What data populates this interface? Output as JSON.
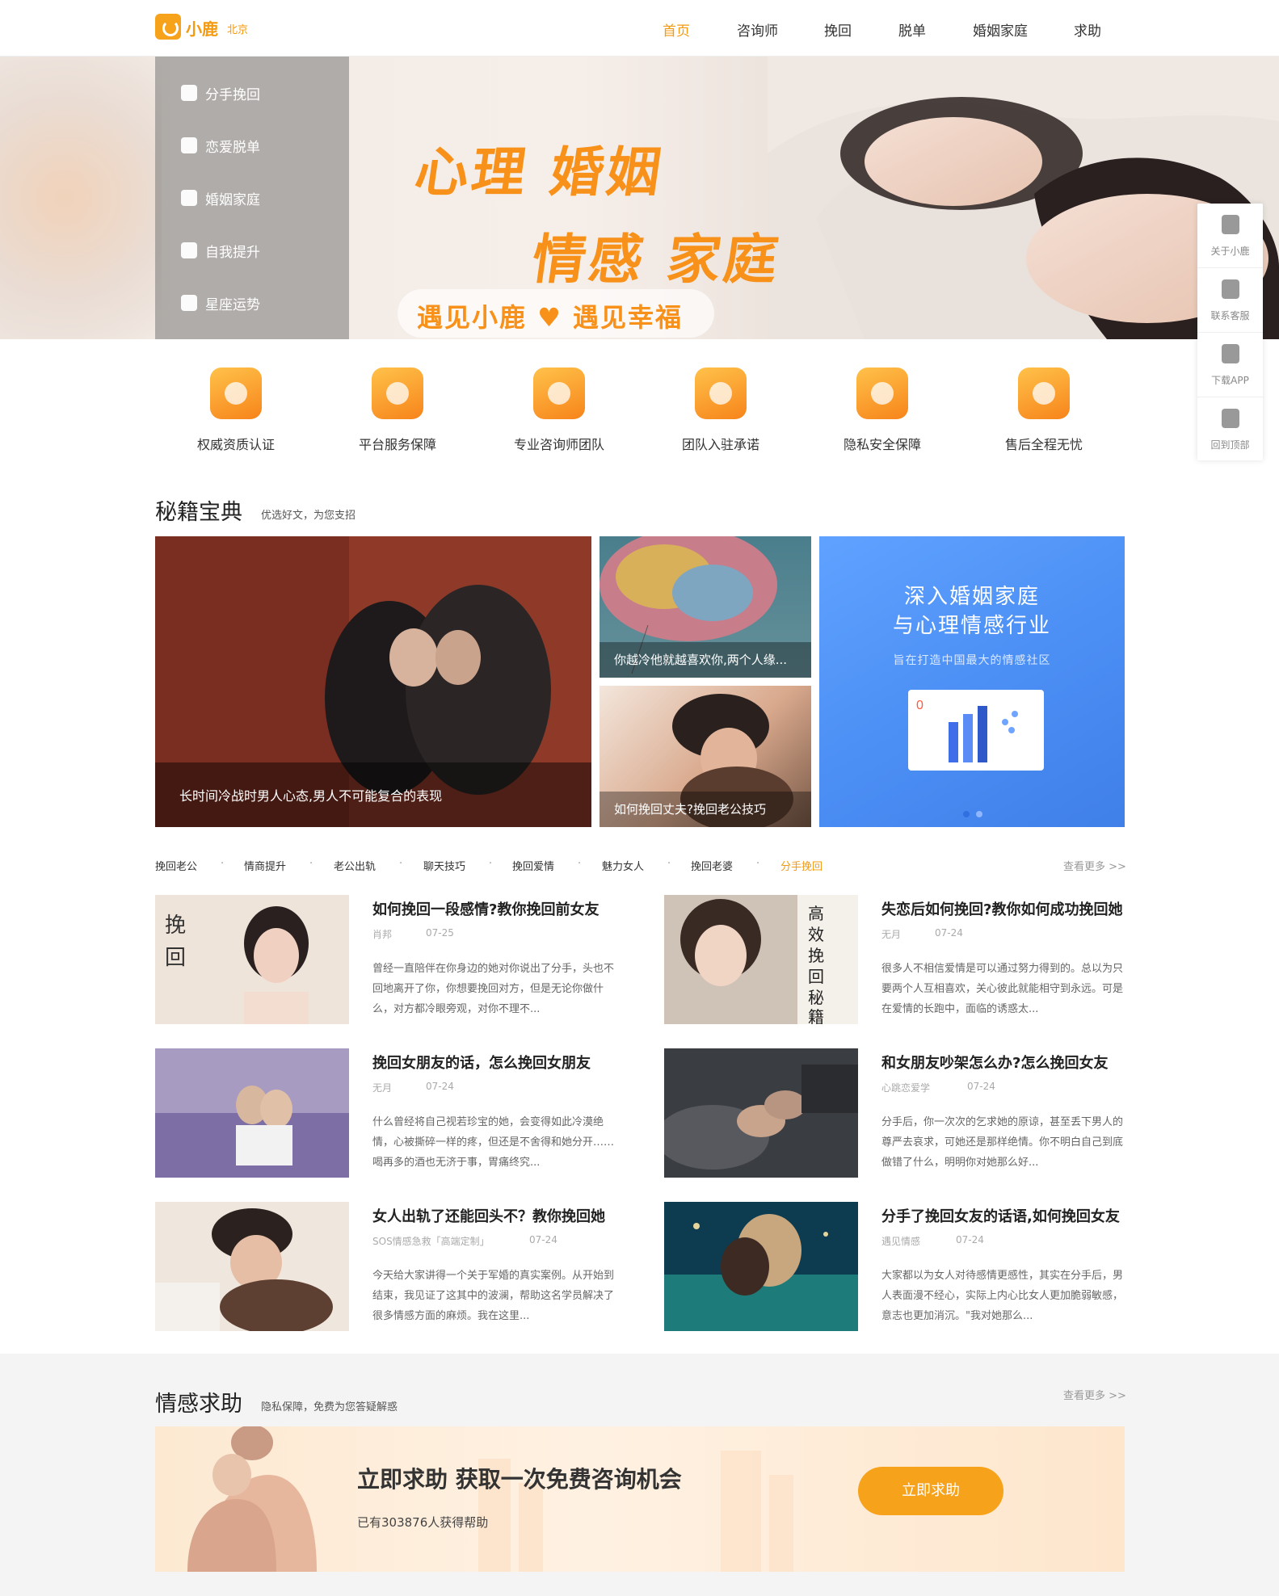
{
  "header": {
    "logo_text": "小鹿",
    "city": "北京",
    "nav": [
      "首页",
      "咨询师",
      "挽回",
      "脱单",
      "婚姻家庭",
      "求助"
    ]
  },
  "banner": {
    "side_menu": [
      "分手挽回",
      "恋爱脱单",
      "婚姻家庭",
      "自我提升",
      "星座运势"
    ],
    "headline_line1": "心理 婚姻",
    "headline_line2": "情感 家庭",
    "slogan": "遇见小鹿 ♥ 遇见幸福"
  },
  "float_bar": [
    "关于小鹿",
    "联系客服",
    "下载APP",
    "回到顶部"
  ],
  "features": [
    "权威资质认证",
    "平台服务保障",
    "专业咨询师团队",
    "团队入驻承诺",
    "隐私安全保障",
    "售后全程无忧"
  ],
  "secrets": {
    "title": "秘籍宝典",
    "subtitle": "优选好文，为您支招",
    "big_caption": "长时间冷战时男人心态,男人不可能复合的表现",
    "small1_caption": "你越冷他就越喜欢你,两个人缘...",
    "small2_caption": "如何挽回丈夫?挽回老公技巧",
    "blue_title1": "深入婚姻家庭",
    "blue_title2": "与心理情感行业",
    "blue_sub": "旨在打造中国最大的情感社区",
    "tags": [
      "挽回老公",
      "情商提升",
      "老公出轨",
      "聊天技巧",
      "挽回爱情",
      "魅力女人",
      "挽回老婆",
      "分手挽回"
    ],
    "more": "查看更多 >>"
  },
  "articles": [
    {
      "title": "如何挽回一段感情?教你挽回前女友",
      "author": "肖邦",
      "date": "07-25",
      "desc": "曾经一直陪伴在你身边的她对你说出了分手，头也不回地离开了你，你想要挽回对方，但是无论你做什么，对方都冷眼旁观，对你不理不..."
    },
    {
      "title": "失恋后如何挽回?教你如何成功挽回她",
      "author": "无月",
      "date": "07-24",
      "desc": "很多人不相信爱情是可以通过努力得到的。总以为只要两个人互相喜欢，关心彼此就能相守到永远。可是在爱情的长跑中，面临的诱惑太..."
    },
    {
      "title": "挽回女朋友的话，怎么挽回女朋友",
      "author": "无月",
      "date": "07-24",
      "desc": "什么曾经将自己视若珍宝的她，会变得如此冷漠绝情，心被撕碎一样的疼，但还是不舍得和她分开……喝再多的酒也无济于事，胃痛终究..."
    },
    {
      "title": "和女朋友吵架怎么办?怎么挽回女友",
      "author": "心跳恋爱学",
      "date": "07-24",
      "desc": "分手后，你一次次的乞求她的原谅，甚至丢下男人的尊严去哀求，可她还是那样绝情。你不明白自己到底做错了什么，明明你对她那么好..."
    },
    {
      "title": "女人出轨了还能回头不？教你挽回她",
      "author": "SOS情感急救「高端定制」",
      "date": "07-24",
      "desc": "今天给大家讲得一个关于军婚的真实案例。从开始到结束，我见证了这其中的波澜，帮助这名学员解决了很多情感方面的麻烦。我在这里..."
    },
    {
      "title": "分手了挽回女友的话语,如何挽回女友",
      "author": "遇见情感",
      "date": "07-24",
      "desc": "大家都以为女人对待感情更感性，其实在分手后，男人表面漫不经心，实际上内心比女人更加脆弱敏感，意志也更加消沉。\"我对她那么..."
    }
  ],
  "help": {
    "title": "情感求助",
    "subtitle": "隐私保障，免费为您答疑解惑",
    "more": "查看更多 >>",
    "banner_title": "立即求助 获取一次免费咨询机会",
    "banner_sub": "已有303876人获得帮助",
    "button": "立即求助"
  },
  "colors": {
    "accent": "#f39a10",
    "blue": "#4b8ef4"
  }
}
